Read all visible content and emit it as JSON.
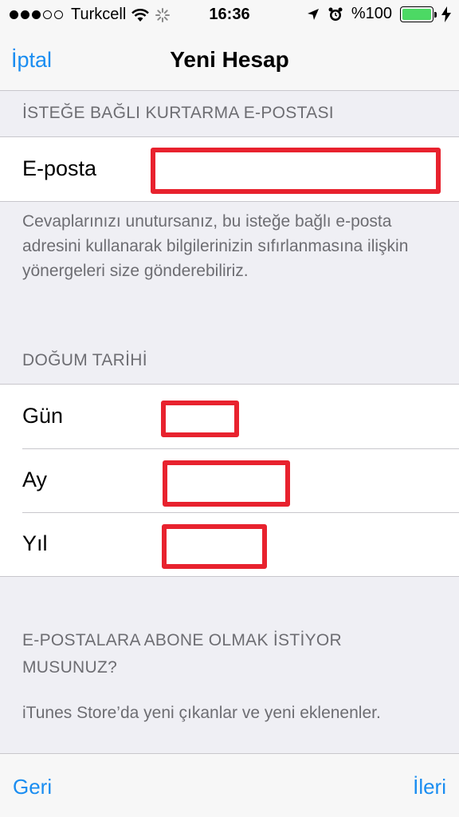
{
  "status_bar": {
    "carrier": "Turkcell",
    "time": "16:36",
    "battery_percent": "%100",
    "signal_filled": 3,
    "signal_total": 5
  },
  "nav": {
    "cancel": "İptal",
    "title": "Yeni Hesap"
  },
  "recovery": {
    "header": "İSTEĞE BAĞLI KURTARMA E-POSTASI",
    "email_label": "E-posta",
    "note": "Cevaplarınızı unutursanız, bu isteğe bağlı e-posta adresini kullanarak bilgilerinizin sıfırlanmasına ilişkin yönergeleri size gönderebiliriz."
  },
  "birth": {
    "header": "DOĞUM TARİHİ",
    "day_label": "Gün",
    "month_label": "Ay",
    "year_label": "Yıl"
  },
  "subscribe": {
    "header": "E-POSTALARA ABONE OLMAK İSTİYOR MUSUNUZ?",
    "note": "iTunes Store’da yeni çıkanlar ve yeni eklenenler."
  },
  "toolbar": {
    "back": "Geri",
    "next": "İleri"
  },
  "colors": {
    "accent": "#1a8df1",
    "redaction": "#e8222e",
    "battery": "#4cd964"
  }
}
